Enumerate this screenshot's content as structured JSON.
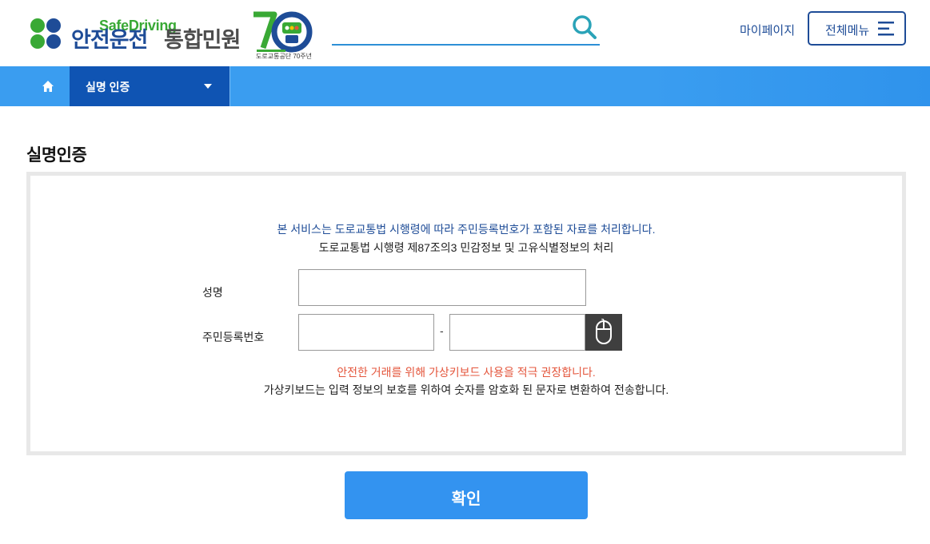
{
  "header": {
    "logo_en": "SafeDriving",
    "logo_ko_main": "안전운전",
    "logo_ko_sub": "통합민원",
    "anniversary_caption": "도로교통공단 70주년",
    "search": {
      "value": "",
      "placeholder": ""
    },
    "mypage_label": "마이페이지",
    "menu_label": "전체메뉴"
  },
  "navbar": {
    "current_label": "실명 인증"
  },
  "main": {
    "title": "실명인증",
    "notice_line1": "본 서비스는 도로교통법 시행령에 따라 주민등록번호가 포함된 자료를 처리합니다.",
    "notice_line2": "도로교통법 시행령 제87조의3 민감정보 및 고유식별정보의 처리",
    "form": {
      "name_label": "성명",
      "name_value": "",
      "rrn_label": "주민등록번호",
      "rrn_front_value": "",
      "rrn_separator": "-",
      "rrn_back_value": ""
    },
    "warning_line1": "안전한 거래를 위해 가상키보드 사용을 적극 권장합니다.",
    "warning_line2": "가상키보드는 입력 정보의 보호를 위하여 숫자를 암호화 된 문자로 변환하여 전송합니다.",
    "confirm_label": "확인"
  },
  "colors": {
    "brand_blue": "#1e4c97",
    "brand_green": "#39a935",
    "nav_blue": "#3a9df0",
    "nav_active": "#0f54b3",
    "warning": "#e4563c",
    "button": "#3393f0"
  },
  "icons": [
    "clover-logo-icon",
    "search-icon",
    "menu-icon",
    "home-icon",
    "chevron-down-icon",
    "mouse-icon"
  ]
}
